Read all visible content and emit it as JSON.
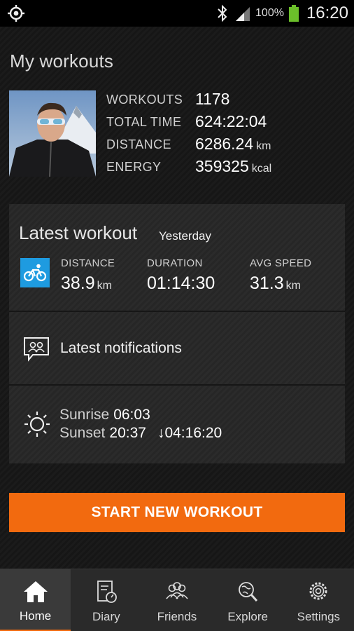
{
  "status_bar": {
    "battery_percent": "100%",
    "time": "16:20"
  },
  "page_title": "My workouts",
  "summary": [
    {
      "label": "WORKOUTS",
      "value": "1178",
      "unit": ""
    },
    {
      "label": "TOTAL TIME",
      "value": "624:22:04",
      "unit": ""
    },
    {
      "label": "DISTANCE",
      "value": "6286.24",
      "unit": "km"
    },
    {
      "label": "ENERGY",
      "value": "359325",
      "unit": "kcal"
    }
  ],
  "latest_workout": {
    "title": "Latest workout",
    "when": "Yesterday",
    "sport_icon": "cycling-icon",
    "distance_label": "DISTANCE",
    "distance_value": "38.9",
    "distance_unit": "km",
    "duration_label": "DURATION",
    "duration_value": "01:14:30",
    "avg_speed_label": "AVG SPEED",
    "avg_speed_value": "31.3",
    "avg_speed_unit": "km"
  },
  "notifications": {
    "label": "Latest notifications"
  },
  "sun": {
    "sunrise_label": "Sunrise",
    "sunrise_time": "06:03",
    "sunset_label": "Sunset",
    "sunset_time": "20:37",
    "day_length": "04:16:20"
  },
  "start_button": "START NEW WORKOUT",
  "tabs": [
    {
      "label": "Home",
      "icon": "home-icon",
      "active": true
    },
    {
      "label": "Diary",
      "icon": "diary-icon",
      "active": false
    },
    {
      "label": "Friends",
      "icon": "friends-icon",
      "active": false
    },
    {
      "label": "Explore",
      "icon": "explore-icon",
      "active": false
    },
    {
      "label": "Settings",
      "icon": "settings-icon",
      "active": false
    }
  ],
  "colors": {
    "accent": "#f26a0f",
    "sport_badge": "#1e9be0"
  }
}
